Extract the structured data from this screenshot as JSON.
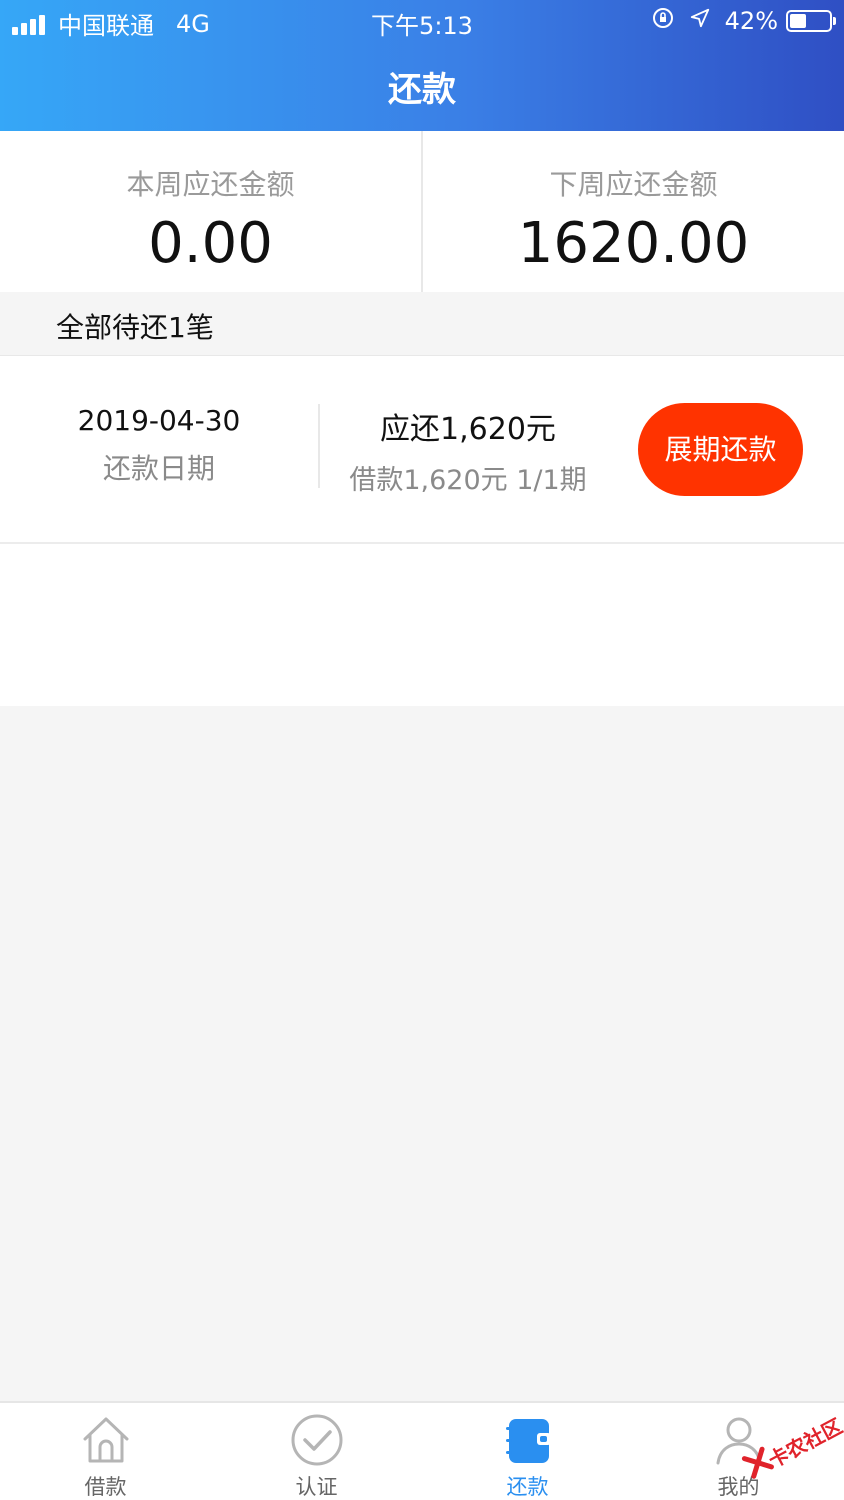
{
  "status_bar": {
    "carrier": "中国联通",
    "network": "4G",
    "time": "下午5:13",
    "battery": "42%",
    "battery_level": 0.42
  },
  "header": {
    "title": "还款"
  },
  "summary": {
    "this_week_label": "本周应还金额",
    "this_week_amount": "0.00",
    "next_week_label": "下周应还金额",
    "next_week_amount": "1620.00"
  },
  "list": {
    "section_title": "全部待还1笔",
    "items": [
      {
        "date": "2019-04-30",
        "date_label": "还款日期",
        "due": "应还1,620元",
        "borrowed": "借款1,620元 1/1期",
        "action": "展期还款"
      }
    ]
  },
  "tabbar": {
    "active": 2,
    "active_color": "#2a8ff0",
    "items": [
      {
        "label": "借款",
        "icon": "home-icon"
      },
      {
        "label": "认证",
        "icon": "check-circle-icon"
      },
      {
        "label": "还款",
        "icon": "notebook-icon"
      },
      {
        "label": "我的",
        "icon": "user-icon"
      }
    ]
  },
  "watermark": {
    "text": "卡农社区"
  },
  "colors": {
    "header_start": "#36a7f7",
    "header_end": "#2f4fc4",
    "action_button": "#ff3300"
  }
}
